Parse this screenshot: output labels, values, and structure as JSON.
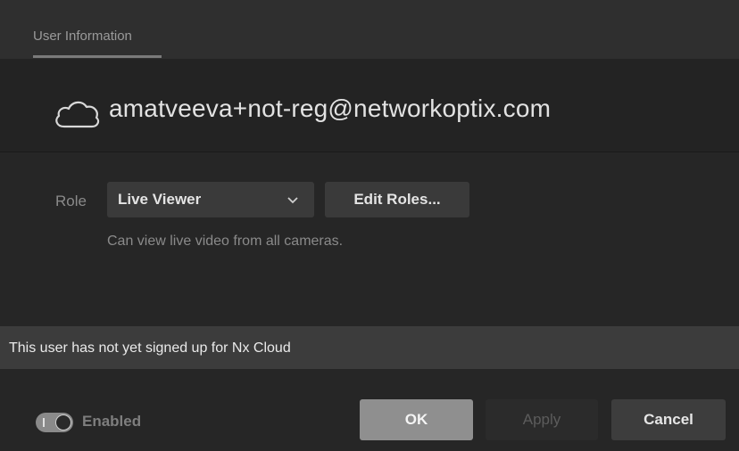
{
  "tabs": [
    {
      "label": "User Information",
      "active": true
    }
  ],
  "header": {
    "email": "amatveeva+not-reg@networkoptix.com",
    "icon": "cloud-icon"
  },
  "role": {
    "label": "Role",
    "selected": "Live Viewer",
    "edit_button": "Edit Roles...",
    "description": "Can view live video from all cameras."
  },
  "banner": {
    "text": "This user has not yet signed up for Nx Cloud"
  },
  "footer": {
    "enabled_label": "Enabled",
    "enabled": true,
    "ok_label": "OK",
    "apply_label": "Apply",
    "cancel_label": "Cancel"
  }
}
